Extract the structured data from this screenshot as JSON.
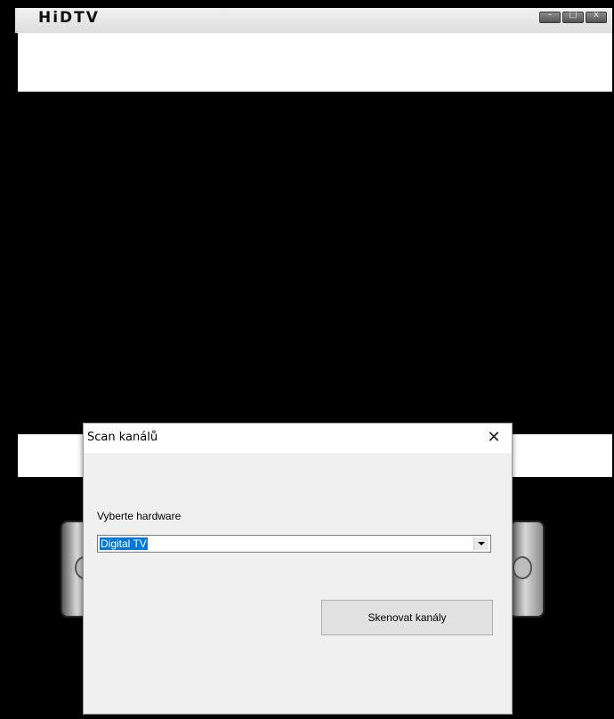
{
  "app": {
    "logo": "HiDTV",
    "window_controls": [
      {
        "name": "minimize",
        "icon": "minimize-icon",
        "glyph": "–"
      },
      {
        "name": "maximize",
        "icon": "maximize-icon",
        "glyph": "□"
      },
      {
        "name": "close",
        "icon": "close-icon",
        "glyph": "x"
      }
    ]
  },
  "dialog": {
    "title": "Scan kanálů",
    "close_icon": "close-icon",
    "close_glyph": "✕",
    "hardware_label": "Vyberte hardware",
    "hardware_select": {
      "selected": "Digital TV",
      "dropdown_icon": "chevron-down-icon"
    },
    "scan_button_label": "Skenovat kanály",
    "colors": {
      "selection": "#0078d7",
      "dialog_bg": "#f0f0f0",
      "button_bg": "#e1e1e1"
    }
  }
}
